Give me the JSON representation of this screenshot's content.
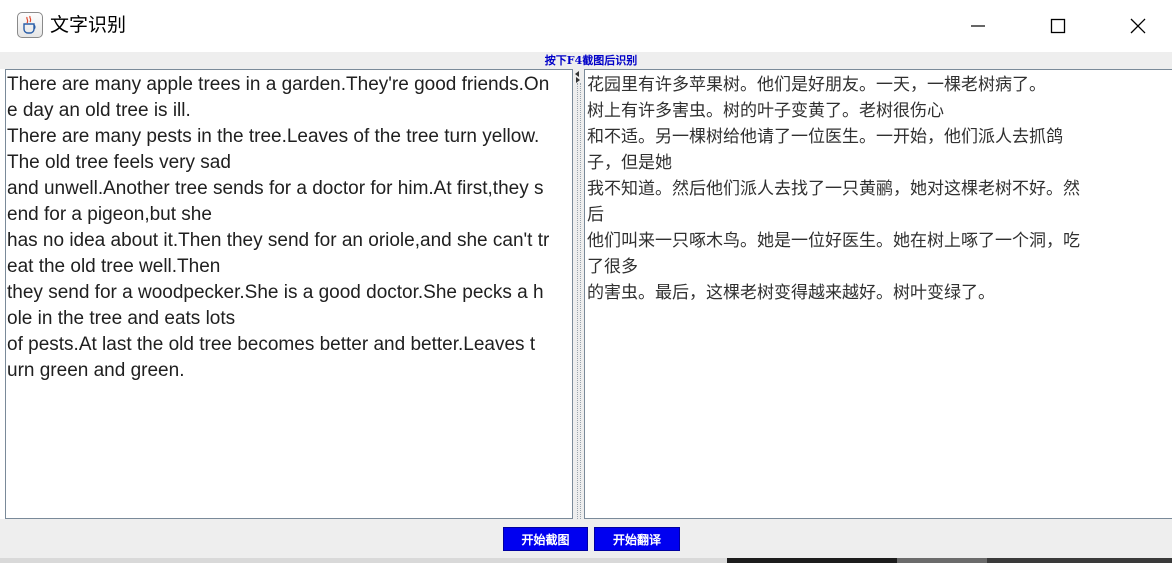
{
  "window": {
    "title": "文字识别",
    "app_icon": "java-cup-icon",
    "controls": [
      "minimize-icon",
      "maximize-icon",
      "close-icon"
    ]
  },
  "hint": "按下F4截图后识别",
  "recognized_text": "There are many apple trees in a garden.They're good friends.On\ne day an old tree is ill.\nThere are many pests in the tree.Leaves of the tree turn yellow.\nThe old tree feels very sad\nand unwell.Another tree sends for a doctor for him.At first,they s\nend for a pigeon,but she\nhas no idea about it.Then they send for an oriole,and she can't tr\neat the old tree well.Then\nthey send for a woodpecker.She is a good doctor.She pecks a h\nole in the tree and eats lots\nof pests.At last the old tree becomes better and better.Leaves t\nurn green and green.",
  "translated_text": "花园里有许多苹果树。他们是好朋友。一天，一棵老树病了。\n树上有许多害虫。树的叶子变黄了。老树很伤心\n和不适。另一棵树给他请了一位医生。一开始，他们派人去抓鸽\n子，但是她\n我不知道。然后他们派人去找了一只黄鹂，她对这棵老树不好。然\n后\n他们叫来一只啄木鸟。她是一位好医生。她在树上啄了一个洞，吃\n了很多\n的害虫。最后，这棵老树变得越来越好。树叶变绿了。",
  "buttons": {
    "capture": "开始截图",
    "translate": "开始翻译"
  },
  "colors": {
    "hint": "#0000c8",
    "button_bg": "#0000f0",
    "button_text": "#ffffff",
    "panel_bg": "#eeeeee"
  }
}
